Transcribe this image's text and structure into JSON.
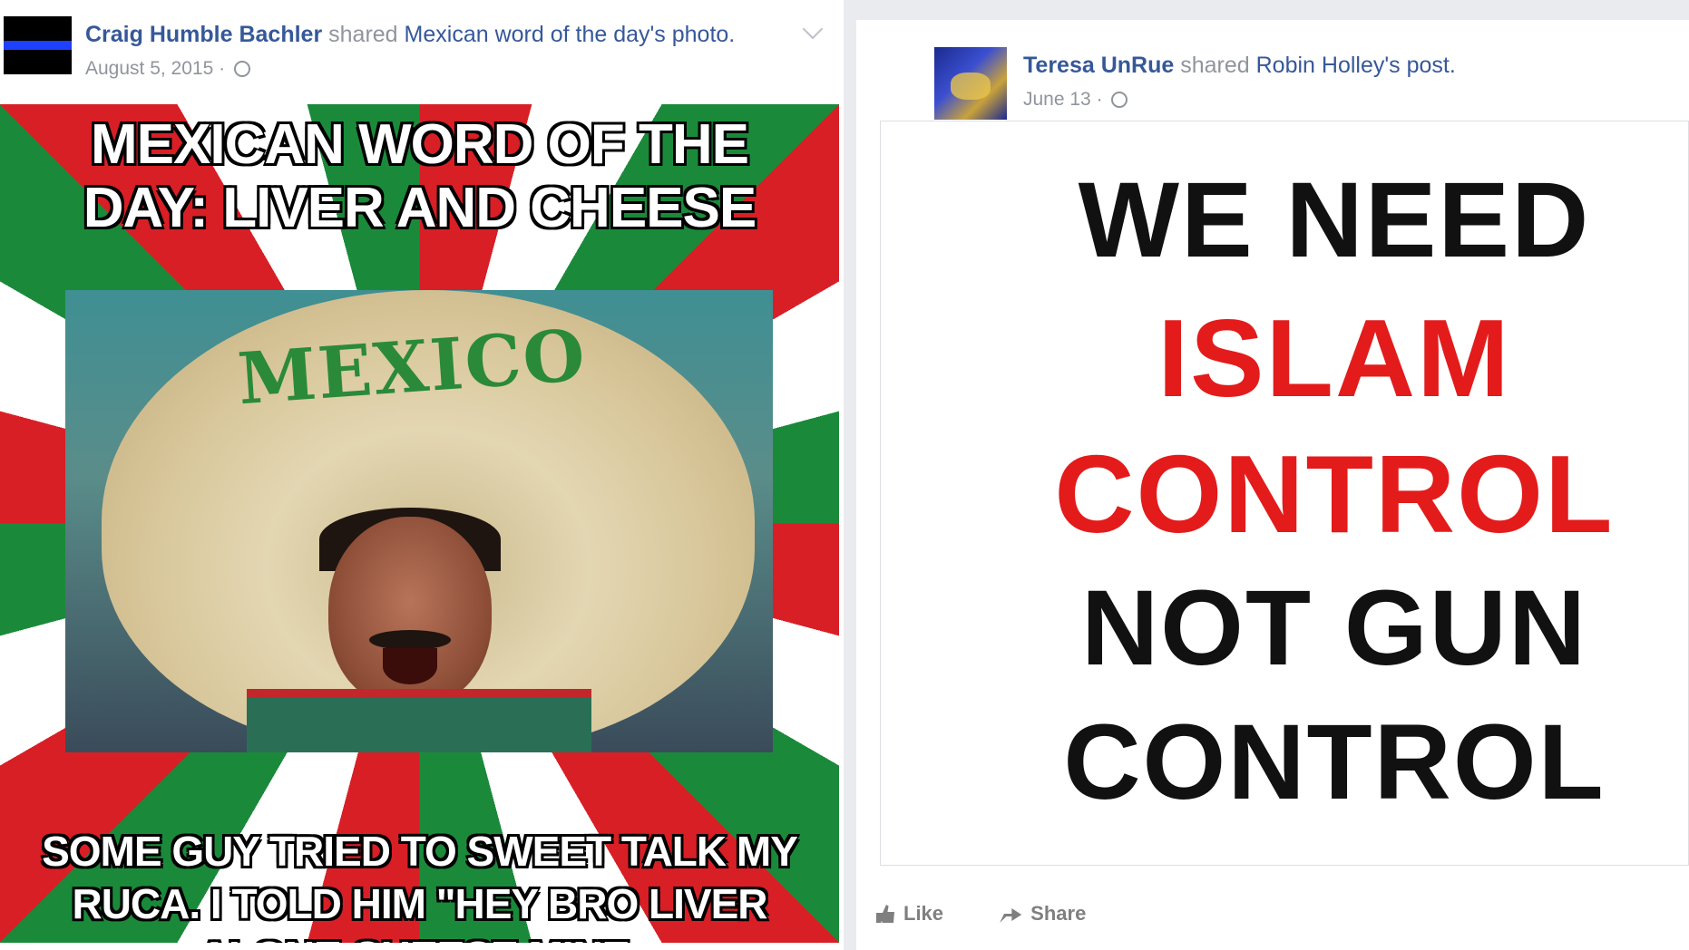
{
  "left_post": {
    "author": "Craig Humble Bachler",
    "action_text": "shared",
    "source": "Mexican word of the day's photo.",
    "date": "August 5, 2015",
    "meme": {
      "top_text": "MEXICAN WORD OF THE DAY: LIVER AND CHEESE",
      "hat_text": "MEXICO",
      "bottom_text": "SOME GUY TRIED TO SWEET TALK MY RUCA. I TOLD HIM \"HEY BRO LIVER ALONE CHEESE MINE."
    }
  },
  "right_post": {
    "author": "Teresa UnRue",
    "action_text": "shared",
    "source": "Robin Holley's post.",
    "date": "June 13",
    "slogan": {
      "line1": "WE NEED",
      "line2": "ISLAM",
      "line3": "CONTROL",
      "line4": "NOT GUN",
      "line5": "CONTROL"
    },
    "actions": {
      "like": "Like",
      "share": "Share"
    }
  },
  "colors": {
    "link": "#365899",
    "meta": "#90949c",
    "slogan_red": "#e31b1b",
    "slogan_black": "#111111",
    "flag_green": "#1a8a3a",
    "flag_red": "#d81f26"
  },
  "icons": [
    "chevron-down-icon",
    "globe-icon",
    "like-icon",
    "share-icon"
  ]
}
